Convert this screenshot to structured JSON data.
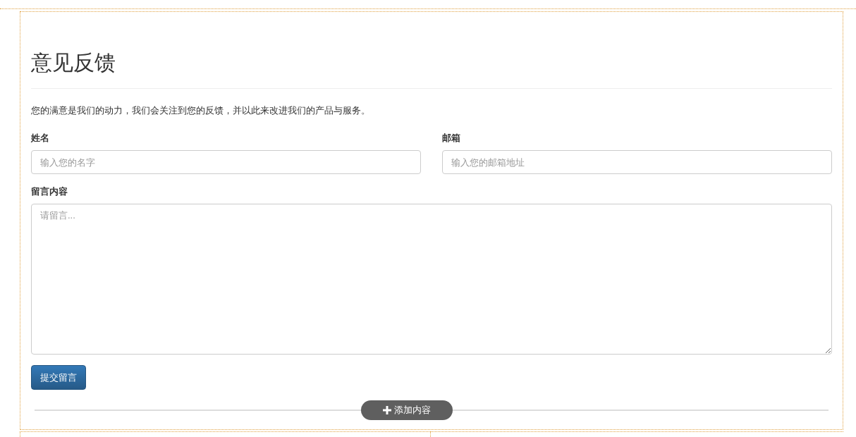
{
  "title": "意见反馈",
  "description": "您的满意是我们的动力，我们会关注到您的反馈，并以此来改进我们的产品与服务。",
  "fields": [
    {
      "label": "姓名",
      "placeholder": "输入您的名字"
    },
    {
      "label": "邮箱",
      "placeholder": "输入您的邮箱地址"
    }
  ],
  "message": {
    "label": "留言内容",
    "placeholder": "请留言..."
  },
  "submit_button": "提交留言",
  "add_content_button": "添加内容"
}
